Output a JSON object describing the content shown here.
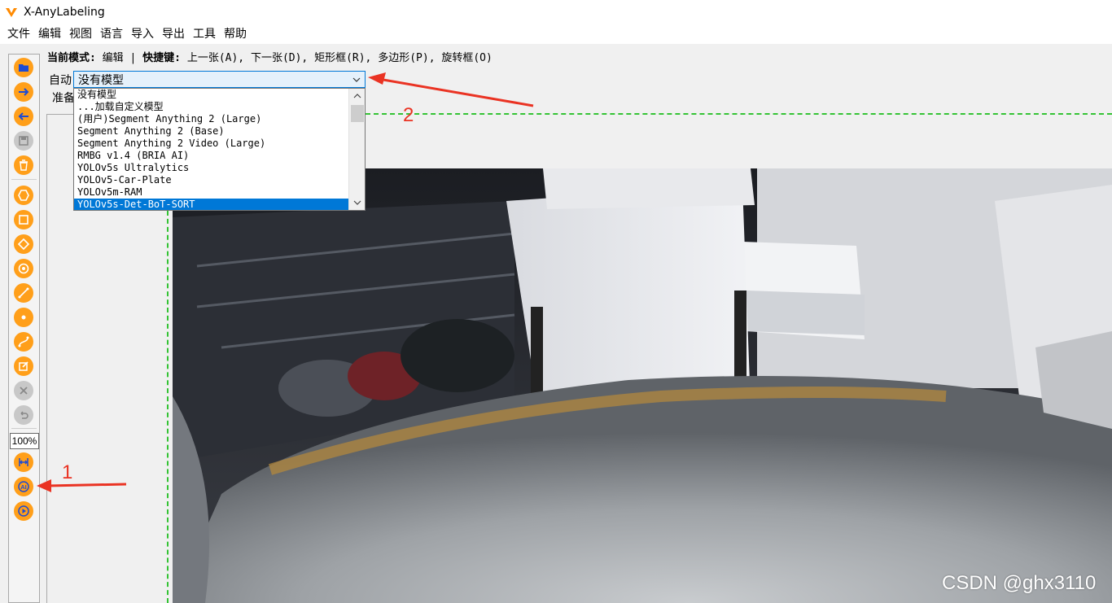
{
  "app": {
    "title": "X-AnyLabeling"
  },
  "menubar": {
    "items": [
      "文件",
      "编辑",
      "视图",
      "语言",
      "导入",
      "导出",
      "工具",
      "帮助"
    ]
  },
  "mode_line": {
    "mode_label": "当前模式:",
    "mode_value": "编辑",
    "separator": "|",
    "shortcut_label": "快捷键:",
    "shortcuts": "上一张(A), 下一张(D), 矩形框(R), 多边形(P), 旋转框(O)"
  },
  "auto_panel": {
    "auto_label": "自动",
    "ready_label": "准备",
    "selected_model": "没有模型",
    "options": [
      "没有模型",
      "...加载自定义模型",
      "(用户)Segment Anything 2 (Large)",
      "Segment Anything 2 (Base)",
      "Segment Anything 2 Video (Large)",
      "RMBG v1.4 (BRIA AI)",
      "YOLOv5s Ultralytics",
      "YOLOv5-Car-Plate",
      "YOLOv5m-RAM",
      "YOLOv5s-Det-BoT-SORT"
    ],
    "highlighted_index": 9
  },
  "toolbar": {
    "zoom": "100%",
    "icons": [
      "open-folder-icon",
      "next-image-icon",
      "prev-image-icon",
      "save-icon",
      "delete-icon",
      "polygon-icon",
      "rectangle-icon",
      "rotation-icon",
      "circle-icon",
      "line-icon",
      "point-icon",
      "linestrip-icon",
      "edit-icon",
      "delete-shape-icon",
      "undo-icon",
      "fit-width-icon",
      "ai-icon",
      "play-icon"
    ]
  },
  "annotations": {
    "label_1": "1",
    "label_2": "2",
    "color": "#ea3323"
  },
  "watermark": "CSDN @ghx3110",
  "colors": {
    "accent": "#ff9f1a",
    "selection": "#0078d7",
    "guide": "#34c334"
  }
}
